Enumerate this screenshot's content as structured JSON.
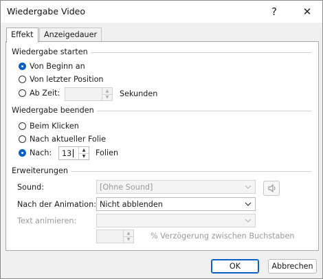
{
  "window": {
    "title": "Wiedergabe Video",
    "help_label": "?",
    "close_label": "✕"
  },
  "tabs": [
    {
      "label": "Effekt",
      "active": true
    },
    {
      "label": "Anzeigedauer",
      "active": false
    }
  ],
  "start": {
    "group_title": "Wiedergabe starten",
    "options": [
      {
        "label": "Von Beginn an",
        "checked": true
      },
      {
        "label": "Von letzter Position",
        "checked": false
      },
      {
        "label": "Ab Zeit:",
        "checked": false
      }
    ],
    "time_value": "",
    "time_unit": "Sekunden"
  },
  "end": {
    "group_title": "Wiedergabe beenden",
    "options": [
      {
        "label": "Beim Klicken",
        "checked": false
      },
      {
        "label": "Nach aktueller Folie",
        "checked": false
      },
      {
        "label": "Nach:",
        "checked": true
      }
    ],
    "after_value": "13",
    "after_unit": "Folien"
  },
  "extensions": {
    "group_title": "Erweiterungen",
    "sound_label": "Sound:",
    "sound_value": "[Ohne Sound]",
    "sound_icon": "speaker-icon",
    "after_animation_label": "Nach der Animation:",
    "after_animation_value": "Nicht abblenden",
    "animate_text_label": "Text animieren:",
    "animate_text_value": "",
    "delay_value": "",
    "delay_label": "% Verzögerung zwischen Buchstaben"
  },
  "footer": {
    "ok_label": "OK",
    "cancel_label": "Abbrechen"
  },
  "colors": {
    "accent": "#0a5fc4",
    "disabled_text": "#9a9a9a"
  }
}
